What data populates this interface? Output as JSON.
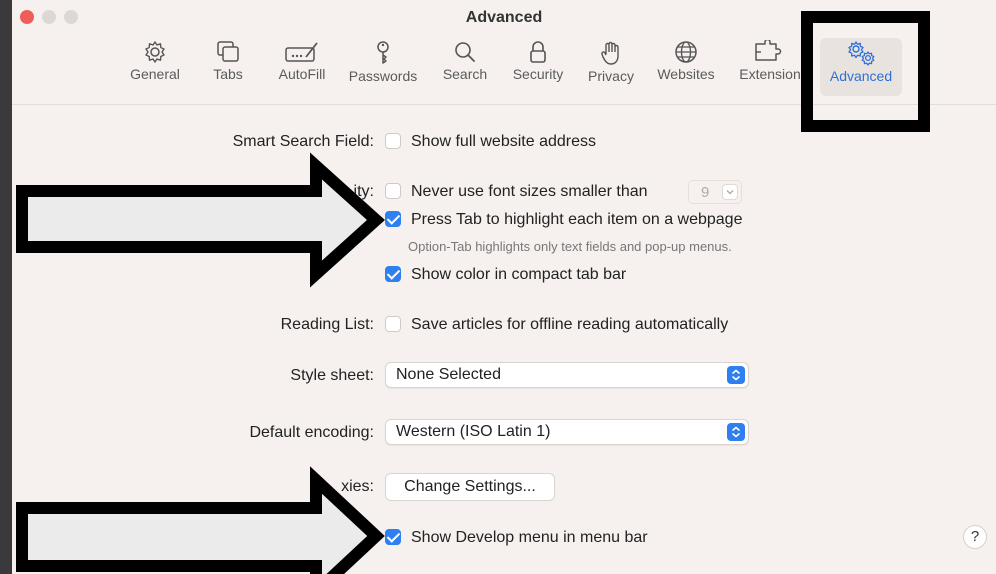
{
  "window": {
    "title": "Advanced"
  },
  "toolbar": {
    "items": [
      {
        "label": "General",
        "icon": "gear-icon"
      },
      {
        "label": "Tabs",
        "icon": "tabs-icon"
      },
      {
        "label": "AutoFill",
        "icon": "autofill-icon"
      },
      {
        "label": "Passwords",
        "icon": "key-icon"
      },
      {
        "label": "Search",
        "icon": "search-icon"
      },
      {
        "label": "Security",
        "icon": "lock-icon"
      },
      {
        "label": "Privacy",
        "icon": "hand-icon"
      },
      {
        "label": "Websites",
        "icon": "globe-icon"
      },
      {
        "label": "Extension",
        "icon": "puzzle-icon"
      },
      {
        "label": "Advanced",
        "icon": "gears-icon",
        "selected": true
      }
    ]
  },
  "settings": {
    "smart_search": {
      "label": "Smart Search Field:",
      "option": "Show full website address",
      "checked": false
    },
    "accessibility": {
      "label": "ity:",
      "never_font": {
        "option": "Never use font sizes smaller than",
        "checked": false,
        "value": "9"
      },
      "press_tab": {
        "option": "Press Tab to highlight each item on a webpage",
        "checked": true,
        "hint": "Option-Tab highlights only text fields and pop-up menus."
      },
      "show_color": {
        "option": "Show color in compact tab bar",
        "checked": true
      }
    },
    "reading_list": {
      "label": "Reading List:",
      "option": "Save articles for offline reading automatically",
      "checked": false
    },
    "style_sheet": {
      "label": "Style sheet:",
      "value": "None Selected"
    },
    "default_encoding": {
      "label": "Default encoding:",
      "value": "Western (ISO Latin 1)"
    },
    "proxies": {
      "label": "xies:",
      "button": "Change Settings..."
    },
    "develop_menu": {
      "option": "Show Develop menu in menu bar",
      "checked": true
    }
  },
  "help": {
    "label": "?"
  },
  "colors": {
    "accent": "#2f7ff0",
    "selected_tab_text": "#2f6fd8",
    "close_button": "#ee5e57"
  }
}
